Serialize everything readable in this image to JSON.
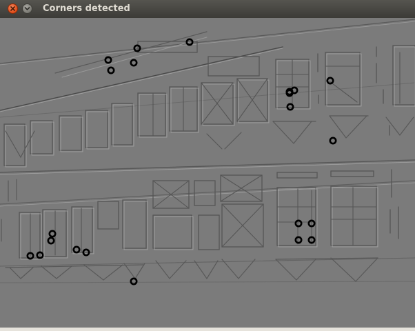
{
  "window": {
    "title": "Corners detected",
    "close_icon": "close-icon",
    "minimize_icon": "minimize-icon"
  },
  "image": {
    "description_kind": "edge-filtered building facade",
    "background_color": "#7b7b7b",
    "marker_color": "#000000",
    "corner_count": 24
  }
}
